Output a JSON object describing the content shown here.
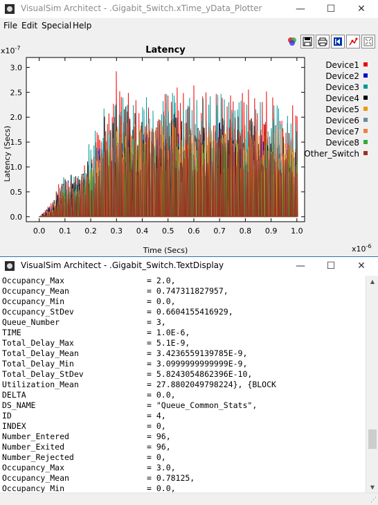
{
  "plotter": {
    "title": "VisualSim Architect - .Gigabit_Switch.xTime_yData_Plotter",
    "menu": [
      "File",
      "Edit",
      "Special",
      "Help"
    ],
    "toolbar_icons": [
      "color-palette-icon",
      "save-icon",
      "print-icon",
      "fit-icon",
      "plot-points-icon",
      "zoom-reset-icon"
    ]
  },
  "chart_data": {
    "type": "line",
    "title": "Latency",
    "xlabel": "Time (Secs)",
    "ylabel": "Latency (Secs)",
    "x_multiplier": "x10-6",
    "y_multiplier": "x10-7",
    "xlim": [
      -0.05,
      1.03
    ],
    "ylim": [
      -0.1,
      3.2
    ],
    "x_ticks": [
      "0.0",
      "0.1",
      "0.2",
      "0.3",
      "0.4",
      "0.5",
      "0.6",
      "0.7",
      "0.8",
      "0.9",
      "1.0"
    ],
    "y_ticks": [
      "0.0",
      "0.5",
      "1.0",
      "1.5",
      "2.0",
      "2.5",
      "3.0"
    ],
    "legend_position": "right",
    "grid": false,
    "series": [
      {
        "name": "Device1",
        "color": "#ee0000",
        "envelope": [
          [
            0.0,
            0.0
          ],
          [
            0.05,
            0.35
          ],
          [
            0.1,
            0.95
          ],
          [
            0.15,
            0.9
          ],
          [
            0.2,
            1.2
          ],
          [
            0.25,
            2.4
          ],
          [
            0.3,
            3.1
          ],
          [
            0.35,
            2.7
          ],
          [
            0.4,
            2.6
          ],
          [
            0.5,
            2.6
          ],
          [
            0.6,
            2.7
          ],
          [
            0.7,
            2.6
          ],
          [
            0.8,
            2.6
          ],
          [
            0.9,
            2.7
          ],
          [
            1.0,
            2.2
          ]
        ]
      },
      {
        "name": "Device2",
        "color": "#0000cc",
        "envelope": [
          [
            0.0,
            0.0
          ],
          [
            0.05,
            0.3
          ],
          [
            0.1,
            0.8
          ],
          [
            0.15,
            0.7
          ],
          [
            0.2,
            1.0
          ],
          [
            0.25,
            1.6
          ],
          [
            0.3,
            1.8
          ],
          [
            0.35,
            1.9
          ],
          [
            0.4,
            1.7
          ],
          [
            0.5,
            1.8
          ],
          [
            0.6,
            1.5
          ],
          [
            0.7,
            1.9
          ],
          [
            0.8,
            1.6
          ],
          [
            0.9,
            1.7
          ],
          [
            1.0,
            1.3
          ]
        ]
      },
      {
        "name": "Device3",
        "color": "#009999",
        "envelope": [
          [
            0.0,
            0.0
          ],
          [
            0.05,
            0.2
          ],
          [
            0.1,
            0.9
          ],
          [
            0.15,
            1.0
          ],
          [
            0.2,
            1.6
          ],
          [
            0.25,
            2.2
          ],
          [
            0.3,
            2.5
          ],
          [
            0.35,
            2.4
          ],
          [
            0.4,
            2.4
          ],
          [
            0.5,
            2.5
          ],
          [
            0.6,
            2.5
          ],
          [
            0.7,
            2.5
          ],
          [
            0.8,
            2.4
          ],
          [
            0.9,
            2.3
          ],
          [
            1.0,
            2.1
          ]
        ]
      },
      {
        "name": "Device4",
        "color": "#000000",
        "envelope": [
          [
            0.0,
            0.0
          ],
          [
            0.05,
            0.25
          ],
          [
            0.1,
            0.85
          ],
          [
            0.15,
            0.85
          ],
          [
            0.2,
            1.3
          ],
          [
            0.25,
            2.0
          ],
          [
            0.3,
            2.3
          ],
          [
            0.35,
            2.2
          ],
          [
            0.4,
            2.0
          ],
          [
            0.5,
            2.1
          ],
          [
            0.6,
            2.0
          ],
          [
            0.7,
            2.0
          ],
          [
            0.8,
            2.0
          ],
          [
            0.9,
            1.9
          ],
          [
            1.0,
            1.6
          ]
        ]
      },
      {
        "name": "Device5",
        "color": "#ee9900",
        "envelope": [
          [
            0.0,
            0.0
          ],
          [
            0.05,
            0.2
          ],
          [
            0.1,
            0.6
          ],
          [
            0.15,
            0.6
          ],
          [
            0.2,
            1.0
          ],
          [
            0.25,
            1.6
          ],
          [
            0.3,
            1.9
          ],
          [
            0.35,
            1.8
          ],
          [
            0.4,
            1.8
          ],
          [
            0.5,
            1.9
          ],
          [
            0.6,
            1.8
          ],
          [
            0.7,
            1.8
          ],
          [
            0.8,
            1.7
          ],
          [
            0.9,
            1.8
          ],
          [
            1.0,
            1.5
          ]
        ]
      },
      {
        "name": "Device6",
        "color": "#6b8e9b",
        "envelope": [
          [
            0.0,
            0.0
          ],
          [
            0.05,
            0.15
          ],
          [
            0.1,
            0.7
          ],
          [
            0.15,
            0.7
          ],
          [
            0.2,
            1.1
          ],
          [
            0.25,
            1.5
          ],
          [
            0.3,
            1.6
          ],
          [
            0.35,
            1.5
          ],
          [
            0.4,
            1.4
          ],
          [
            0.5,
            1.5
          ],
          [
            0.6,
            1.4
          ],
          [
            0.7,
            1.5
          ],
          [
            0.8,
            1.4
          ],
          [
            0.9,
            1.4
          ],
          [
            1.0,
            1.2
          ]
        ]
      },
      {
        "name": "Device7",
        "color": "#f08040",
        "envelope": [
          [
            0.0,
            0.0
          ],
          [
            0.05,
            0.2
          ],
          [
            0.1,
            0.65
          ],
          [
            0.15,
            0.65
          ],
          [
            0.2,
            1.0
          ],
          [
            0.25,
            1.7
          ],
          [
            0.3,
            2.0
          ],
          [
            0.35,
            1.9
          ],
          [
            0.4,
            1.9
          ],
          [
            0.5,
            2.0
          ],
          [
            0.6,
            1.9
          ],
          [
            0.7,
            1.9
          ],
          [
            0.8,
            1.9
          ],
          [
            0.9,
            1.9
          ],
          [
            1.0,
            1.6
          ]
        ]
      },
      {
        "name": "Device8",
        "color": "#33aa33",
        "envelope": [
          [
            0.0,
            0.0
          ],
          [
            0.05,
            0.15
          ],
          [
            0.1,
            0.6
          ],
          [
            0.15,
            0.6
          ],
          [
            0.2,
            1.0
          ],
          [
            0.25,
            1.4
          ],
          [
            0.3,
            1.7
          ],
          [
            0.35,
            1.6
          ],
          [
            0.4,
            1.6
          ],
          [
            0.5,
            1.7
          ],
          [
            0.6,
            1.6
          ],
          [
            0.7,
            1.6
          ],
          [
            0.8,
            1.6
          ],
          [
            0.9,
            1.5
          ],
          [
            1.0,
            1.3
          ]
        ]
      },
      {
        "name": "Other_Switch",
        "color": "#993322",
        "envelope": [
          [
            0.0,
            0.0
          ],
          [
            0.05,
            0.2
          ],
          [
            0.1,
            0.75
          ],
          [
            0.15,
            0.8
          ],
          [
            0.2,
            1.1
          ],
          [
            0.25,
            1.8
          ],
          [
            0.3,
            2.1
          ],
          [
            0.35,
            2.0
          ],
          [
            0.4,
            1.9
          ],
          [
            0.5,
            2.0
          ],
          [
            0.6,
            2.0
          ],
          [
            0.7,
            2.0
          ],
          [
            0.8,
            1.9
          ],
          [
            0.9,
            2.0
          ],
          [
            1.0,
            1.7
          ]
        ]
      }
    ]
  },
  "display": {
    "title": "VisualSim Architect - .Gigabit_Switch.TextDisplay",
    "lines": [
      {
        "k": "Occupancy_Max",
        "v": "= 2.0,"
      },
      {
        "k": "Occupancy_Mean",
        "v": "= 0.747311827957,"
      },
      {
        "k": "Occupancy_Min",
        "v": "= 0.0,"
      },
      {
        "k": "Occupancy_StDev",
        "v": "= 0.6604155416929,"
      },
      {
        "k": "Queue_Number",
        "v": "= 3,"
      },
      {
        "k": "TIME",
        "v": "= 1.0E-6,"
      },
      {
        "k": "Total_Delay_Max",
        "v": "= 5.1E-9,"
      },
      {
        "k": "Total_Delay_Mean",
        "v": "= 3.4236559139785E-9,"
      },
      {
        "k": "Total_Delay_Min",
        "v": "= 3.0999999999999E-9,"
      },
      {
        "k": "Total_Delay_StDev",
        "v": "= 5.8243054862396E-10,"
      },
      {
        "k": "Utilization_Mean",
        "v": "= 27.8802049798224}, {BLOCK"
      },
      {
        "k": "DELTA",
        "v": "= 0.0,"
      },
      {
        "k": "DS_NAME",
        "v": "= \"Queue_Common_Stats\","
      },
      {
        "k": "ID",
        "v": "= 4,"
      },
      {
        "k": "INDEX",
        "v": "= 0,"
      },
      {
        "k": "Number_Entered",
        "v": "= 96,"
      },
      {
        "k": "Number_Exited",
        "v": "= 96,"
      },
      {
        "k": "Number_Rejected",
        "v": "= 0,"
      },
      {
        "k": "Occupancy_Max",
        "v": "= 3.0,"
      },
      {
        "k": "Occupancy_Mean",
        "v": "= 0.78125,"
      },
      {
        "k": "Occupancy_Min",
        "v": "= 0.0,"
      }
    ]
  },
  "window_controls": {
    "minimize": "—",
    "maximize": "☐",
    "close": "✕"
  }
}
